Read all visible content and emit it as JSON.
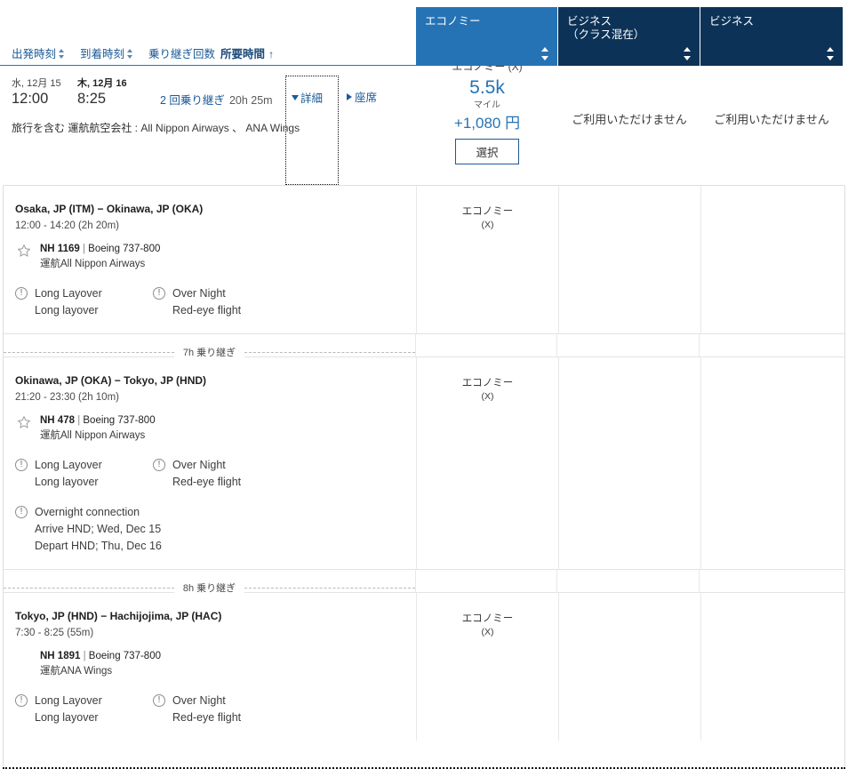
{
  "cabin_tabs": [
    {
      "label": "エコノミー",
      "state": "active",
      "sort_icon": "sort-updown-icon"
    },
    {
      "label": "ビジネス\n（クラス混在）",
      "state": "inactive",
      "sort_icon": "sort-updown-icon"
    },
    {
      "label": "ビジネス",
      "state": "inactive",
      "sort_icon": "sort-updown-icon"
    }
  ],
  "sort_bar": {
    "departure": "出発時刻",
    "arrival": "到着時刻",
    "stops": "乗り継ぎ回数",
    "duration": "所要時間",
    "duration_direction": "↑"
  },
  "summary": {
    "depart_date": "水, 12月 15",
    "depart_time": "12:00",
    "arrive_date": "木, 12月 16",
    "arrive_time": "8:25",
    "stops": "2 回乗り継ぎ",
    "duration": "20h 25m",
    "carriers_label": "旅行を含む 運航航空会社 :",
    "carriers_value": "All Nippon Airways 、 ANA Wings",
    "details_link": "詳細",
    "seats_link": "座席"
  },
  "fares": [
    {
      "clipped_label": "エコノミー (X)",
      "miles": "5.5k",
      "miles_unit": "マイル",
      "price": "+1,080 円",
      "select_label": "選択",
      "available": true
    },
    {
      "unavailable_text": "ご利用いただけません",
      "available": false
    },
    {
      "unavailable_text": "ご利用いただけません",
      "available": false
    }
  ],
  "segments": [
    {
      "route": "Osaka, JP (ITM)  −  Okinawa, JP (OKA)",
      "times": "12:00 - 14:20 (2h 20m)",
      "has_star": true,
      "flight_no": "NH 1169",
      "aircraft": "Boeing 737-800",
      "operated": "運航All Nippon Airways",
      "cabin": "エコノミー",
      "cabin_code": "(X)",
      "warnings": [
        {
          "title": "Long Layover",
          "sub": "Long layover"
        },
        {
          "title": "Over Night",
          "sub": "Red-eye flight"
        }
      ]
    },
    {
      "route": "Okinawa, JP (OKA)  −  Tokyo, JP (HND)",
      "times": "21:20 - 23:30 (2h 10m)",
      "has_star": true,
      "flight_no": "NH 478",
      "aircraft": "Boeing 737-800",
      "operated": "運航All Nippon Airways",
      "cabin": "エコノミー",
      "cabin_code": "(X)",
      "warnings": [
        {
          "title": "Long Layover",
          "sub": "Long layover"
        },
        {
          "title": "Over Night",
          "sub": "Red-eye flight"
        }
      ],
      "extra_warning": {
        "title": "Overnight connection",
        "line1": "Arrive HND; Wed, Dec 15",
        "line2": "Depart HND; Thu, Dec 16"
      }
    },
    {
      "route": "Tokyo, JP (HND)  −  Hachijojima, JP (HAC)",
      "times": "7:30 - 8:25 (55m)",
      "has_star": false,
      "flight_no": "NH 1891",
      "aircraft": "Boeing 737-800",
      "operated": "運航ANA Wings",
      "cabin": "エコノミー",
      "cabin_code": "(X)",
      "warnings": [
        {
          "title": "Long Layover",
          "sub": "Long layover"
        },
        {
          "title": "Over Night",
          "sub": "Red-eye flight"
        }
      ]
    }
  ],
  "layovers": [
    {
      "text": "7h 乗り継ぎ"
    },
    {
      "text": "8h 乗り継ぎ"
    }
  ],
  "colors": {
    "active_tab": "#2573b5",
    "inactive_tab": "#0d3257",
    "link_blue": "#1b5a96",
    "price_blue": "#2573b5"
  }
}
